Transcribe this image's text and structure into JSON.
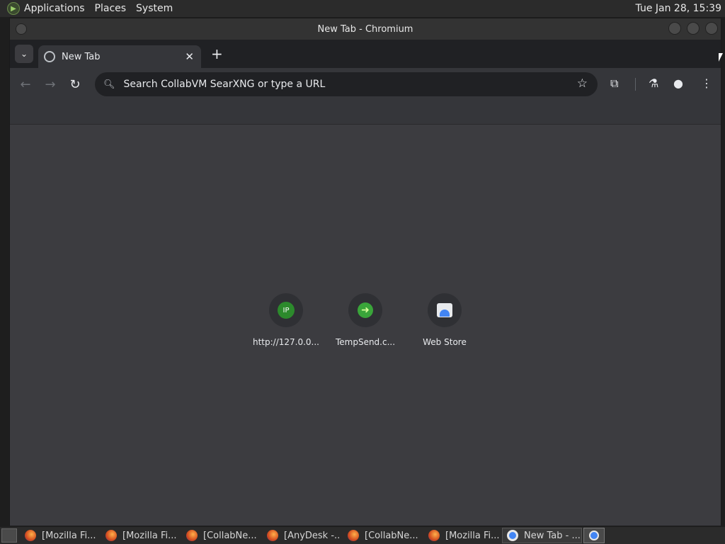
{
  "topbar": {
    "menus": [
      "Applications",
      "Places",
      "System"
    ],
    "clock": "Tue Jan 28, 15:39"
  },
  "window": {
    "title": "New Tab - Chromium"
  },
  "tabs": {
    "active_label": "New Tab",
    "close_symbol": "✕",
    "new_tab_symbol": "+"
  },
  "toolbar": {
    "omnibox_placeholder": "Search CollabVM SearXNG or type a URL"
  },
  "shortcuts": [
    {
      "label": "http://127.0.0...",
      "icon": "ip-icon",
      "icon_text": "IP"
    },
    {
      "label": "TempSend.c...",
      "icon": "tempsend-icon",
      "icon_text": "➜"
    },
    {
      "label": "Web Store",
      "icon": "webstore-icon",
      "icon_text": ""
    }
  ],
  "taskbar": {
    "tasks": [
      {
        "label": "[Mozilla Fi...",
        "icon": "firefox-icon"
      },
      {
        "label": "[Mozilla Fi...",
        "icon": "firefox-icon"
      },
      {
        "label": "[CollabNe...",
        "icon": "firefox-icon"
      },
      {
        "label": "[AnyDesk -...",
        "icon": "firefox-icon"
      },
      {
        "label": "[CollabNe...",
        "icon": "firefox-icon"
      },
      {
        "label": "[Mozilla Fi...",
        "icon": "firefox-icon"
      },
      {
        "label": "New Tab - ...",
        "icon": "chromium-icon"
      }
    ]
  }
}
